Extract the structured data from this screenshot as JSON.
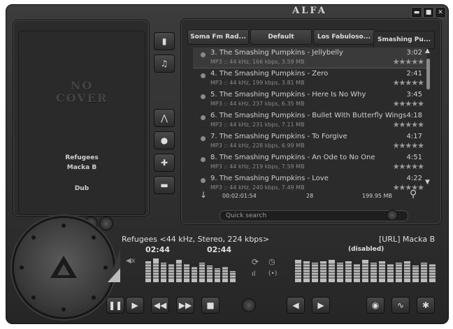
{
  "app": {
    "title": "ALFA"
  },
  "window_controls": {
    "minimize": "▬",
    "maximize": "■",
    "close": "✕"
  },
  "cover": {
    "placeholder_line1": "NO",
    "placeholder_line2": "COVER",
    "title": "Refugees",
    "artist": "Macka B",
    "genre": "Dub"
  },
  "side_buttons": [
    {
      "icon": "new-file-icon",
      "glyph": "▮"
    },
    {
      "icon": "headphones-icon",
      "glyph": "♫"
    },
    {
      "icon": "sort-icon",
      "glyph": "⋀"
    },
    {
      "icon": "playlist-icon",
      "glyph": "●"
    },
    {
      "icon": "add-icon",
      "glyph": "✚"
    },
    {
      "icon": "remove-icon",
      "glyph": "▬"
    }
  ],
  "tabs": [
    {
      "label": "Soma Fm Rad...",
      "active": false
    },
    {
      "label": "Default",
      "active": false
    },
    {
      "label": "Los Fabuloso...",
      "active": false
    },
    {
      "label": "Smashing Pu...",
      "active": true
    }
  ],
  "playlist": [
    {
      "title": "3. The Smashing Pumpkins - Jellybelly",
      "duration": "3:02",
      "info": "MP3 :: 44 kHz, 166 kbps, 3.59 MB",
      "stars": "★★★★★",
      "selected": true
    },
    {
      "title": "4. The Smashing Pumpkins - Zero",
      "duration": "2:41",
      "info": "MP3 :: 44 kHz, 199 kbps, 3.81 MB",
      "stars": "★★★★★"
    },
    {
      "title": "5. The Smashing Pumpkins - Here Is No Why",
      "duration": "3:45",
      "info": "MP3 :: 44 kHz, 237 kbps, 6.35 MB",
      "stars": "★★★★★"
    },
    {
      "title": "6. The Smashing Pumpkins - Bullet With Butterfly Wings",
      "duration": "4:18",
      "info": "MP3 :: 44 kHz, 231 kbps, 7.11 MB",
      "stars": "★★★★★"
    },
    {
      "title": "7. The Smashing Pumpkins - To Forgive",
      "duration": "4:17",
      "info": "MP3 :: 44 kHz, 228 kbps, 6.99 MB",
      "stars": "★★★★★"
    },
    {
      "title": "8. The Smashing Pumpkins - An Ode to No One",
      "duration": "4:51",
      "info": "MP3 :: 44 kHz, 219 kbps, 7.59 MB",
      "stars": "★★★★★"
    },
    {
      "title": "9. The Smashing Pumpkins - Love",
      "duration": "4:22",
      "info": "MP3 :: 44 kHz, 240 kbps, 7.49 MB",
      "stars": "★★★★★"
    }
  ],
  "playlist_status": {
    "total_time": "00:02:01:54",
    "count": "28",
    "size": "199.95 MB"
  },
  "search": {
    "placeholder": "Quick search"
  },
  "now_playing": {
    "line": "Refugees <44 kHz, Stereo, 224 kbps>",
    "elapsed": "02:44",
    "remaining": "02:44",
    "stream": "[URL] Macka B",
    "status": "(disabled)"
  },
  "controls": {
    "pause": "❚❚",
    "play": "▶",
    "prev": "◀◀",
    "next": "▶▶",
    "stop": "■",
    "back": "◀",
    "forward": "▶",
    "power": "◉",
    "eq": "∿",
    "settings": "✱"
  },
  "colors": {
    "background": "#2b2b2b",
    "text": "#d0d0d0",
    "accent": "#bdbdbd"
  }
}
